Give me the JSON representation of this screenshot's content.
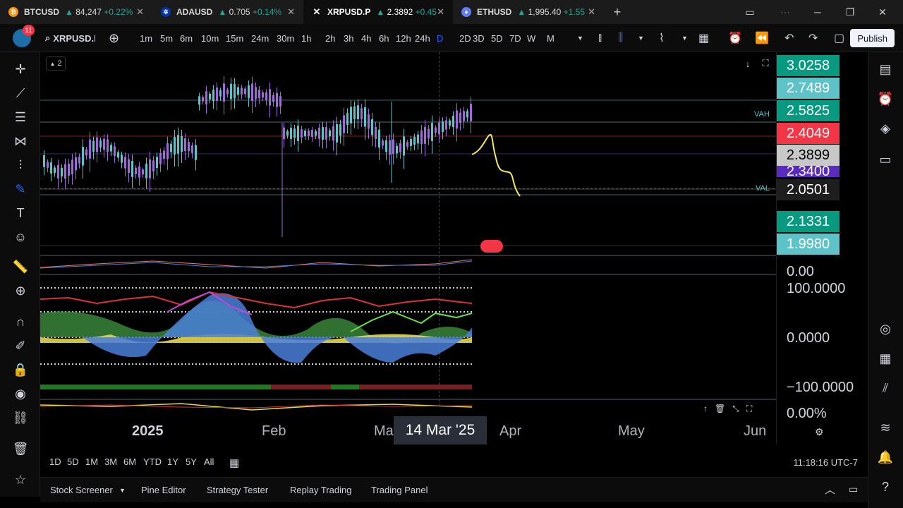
{
  "browser_tabs": [
    {
      "symbol": "BTCUSD",
      "arrow": "▲",
      "price": "84,247",
      "change": "+0.22%",
      "icon": "bitcoin-icon",
      "color": "#f7931a",
      "glyph": "₿"
    },
    {
      "symbol": "ADAUSD",
      "arrow": "▲",
      "price": "0.705",
      "change": "+0.14%",
      "icon": "cardano-icon",
      "color": "#0033ad",
      "glyph": "✲"
    },
    {
      "symbol": "XRPUSD.P",
      "arrow": "▲",
      "price": "2.3892",
      "change": "+0.45",
      "icon": "xrp-icon",
      "color": "#111111",
      "glyph": "✕"
    },
    {
      "symbol": "ETHUSD",
      "arrow": "▲",
      "price": "1,995.40",
      "change": "+1.55",
      "icon": "ethereum-icon",
      "color": "#627eea",
      "glyph": "♦"
    }
  ],
  "toolbar": {
    "notification_count": "11",
    "symbol": "XRPUSD.P",
    "intervals": [
      "1m",
      "5m",
      "6m",
      "10m",
      "15m",
      "24m",
      "30m",
      "1h",
      "2h",
      "3h",
      "4h",
      "6h",
      "12h",
      "24h",
      "D",
      "2D",
      "3D",
      "5D",
      "7D",
      "W",
      "M"
    ],
    "active_interval": "D",
    "publish_label": "Publish"
  },
  "chart": {
    "pane_count_label": "2",
    "vah_label": "VAH",
    "val_label": "VAL",
    "price_labels": [
      {
        "value": "3.0258",
        "bg": "#089981"
      },
      {
        "value": "2.7489",
        "bg": "#5ec3c9"
      },
      {
        "value": "2.5825",
        "bg": "#089981"
      },
      {
        "value": "2.4049",
        "bg": "#f23645"
      },
      {
        "value": "2.3899",
        "bg": "#c8c8c8"
      },
      {
        "value": "2.3400",
        "bg": "#5b2bc0"
      },
      {
        "value": "2.0501",
        "bg": "#1e1e1e"
      },
      {
        "value": "2.1331",
        "bg": "#089981"
      },
      {
        "value": "1.9980",
        "bg": "#5ec3c9"
      }
    ],
    "osc1_value": "0.00",
    "osc2_values": [
      "100.0000",
      "0.0000",
      "−100.0000"
    ],
    "osc3_value": "0.00%"
  },
  "time_axis": {
    "labels": [
      "2025",
      "Feb",
      "Ma",
      "Apr",
      "May",
      "Jun"
    ],
    "crosshair_date": "14 Mar '25"
  },
  "range_bar": {
    "ranges": [
      "1D",
      "5D",
      "1M",
      "3M",
      "6M",
      "YTD",
      "1Y",
      "5Y",
      "All"
    ],
    "clock": "11:18:16 UTC-7"
  },
  "bottom_panels": [
    "Stock Screener",
    "Pine Editor",
    "Strategy Tester",
    "Replay Trading",
    "Trading Panel"
  ]
}
